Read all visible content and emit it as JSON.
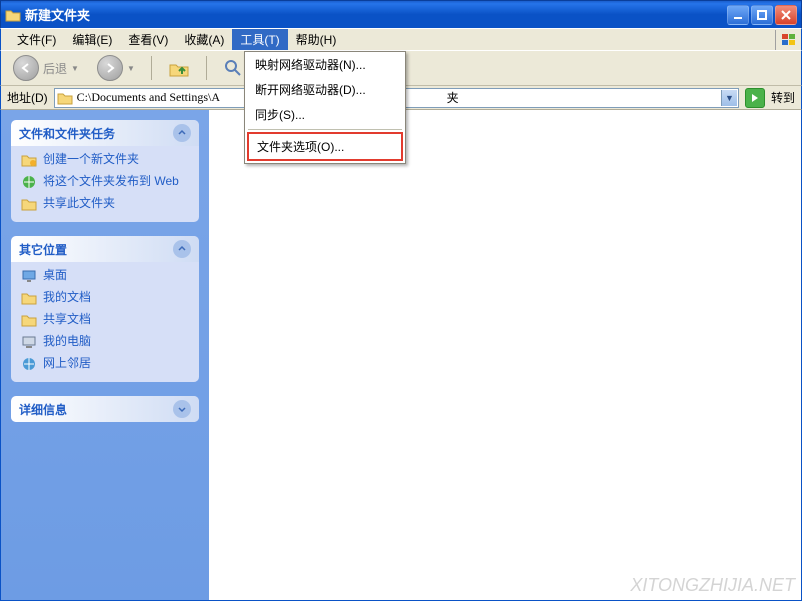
{
  "window": {
    "title": "新建文件夹"
  },
  "menu": {
    "file": "文件(F)",
    "edit": "编辑(E)",
    "view": "查看(V)",
    "favorites": "收藏(A)",
    "tools": "工具(T)",
    "help": "帮助(H)"
  },
  "tools_dropdown": {
    "map_drive": "映射网络驱动器(N)...",
    "disconnect_drive": "断开网络驱动器(D)...",
    "sync": "同步(S)...",
    "folder_options": "文件夹选项(O)..."
  },
  "toolbar": {
    "back": "后退",
    "search": "搜索"
  },
  "address": {
    "label": "地址(D)",
    "path": "C:\\Documents and Settings\\A",
    "partial_text": "夹",
    "go": "转到"
  },
  "sidepanel": {
    "group1": {
      "title": "文件和文件夹任务",
      "items": {
        "create": "创建一个新文件夹",
        "publish": "将这个文件夹发布到 Web",
        "share": "共享此文件夹"
      }
    },
    "group2": {
      "title": "其它位置",
      "items": {
        "desktop": "桌面",
        "mydocs": "我的文档",
        "shared": "共享文档",
        "mycomputer": "我的电脑",
        "network": "网上邻居"
      }
    },
    "group3": {
      "title": "详细信息"
    }
  },
  "watermark": "XITONGZHIJIA.NET"
}
